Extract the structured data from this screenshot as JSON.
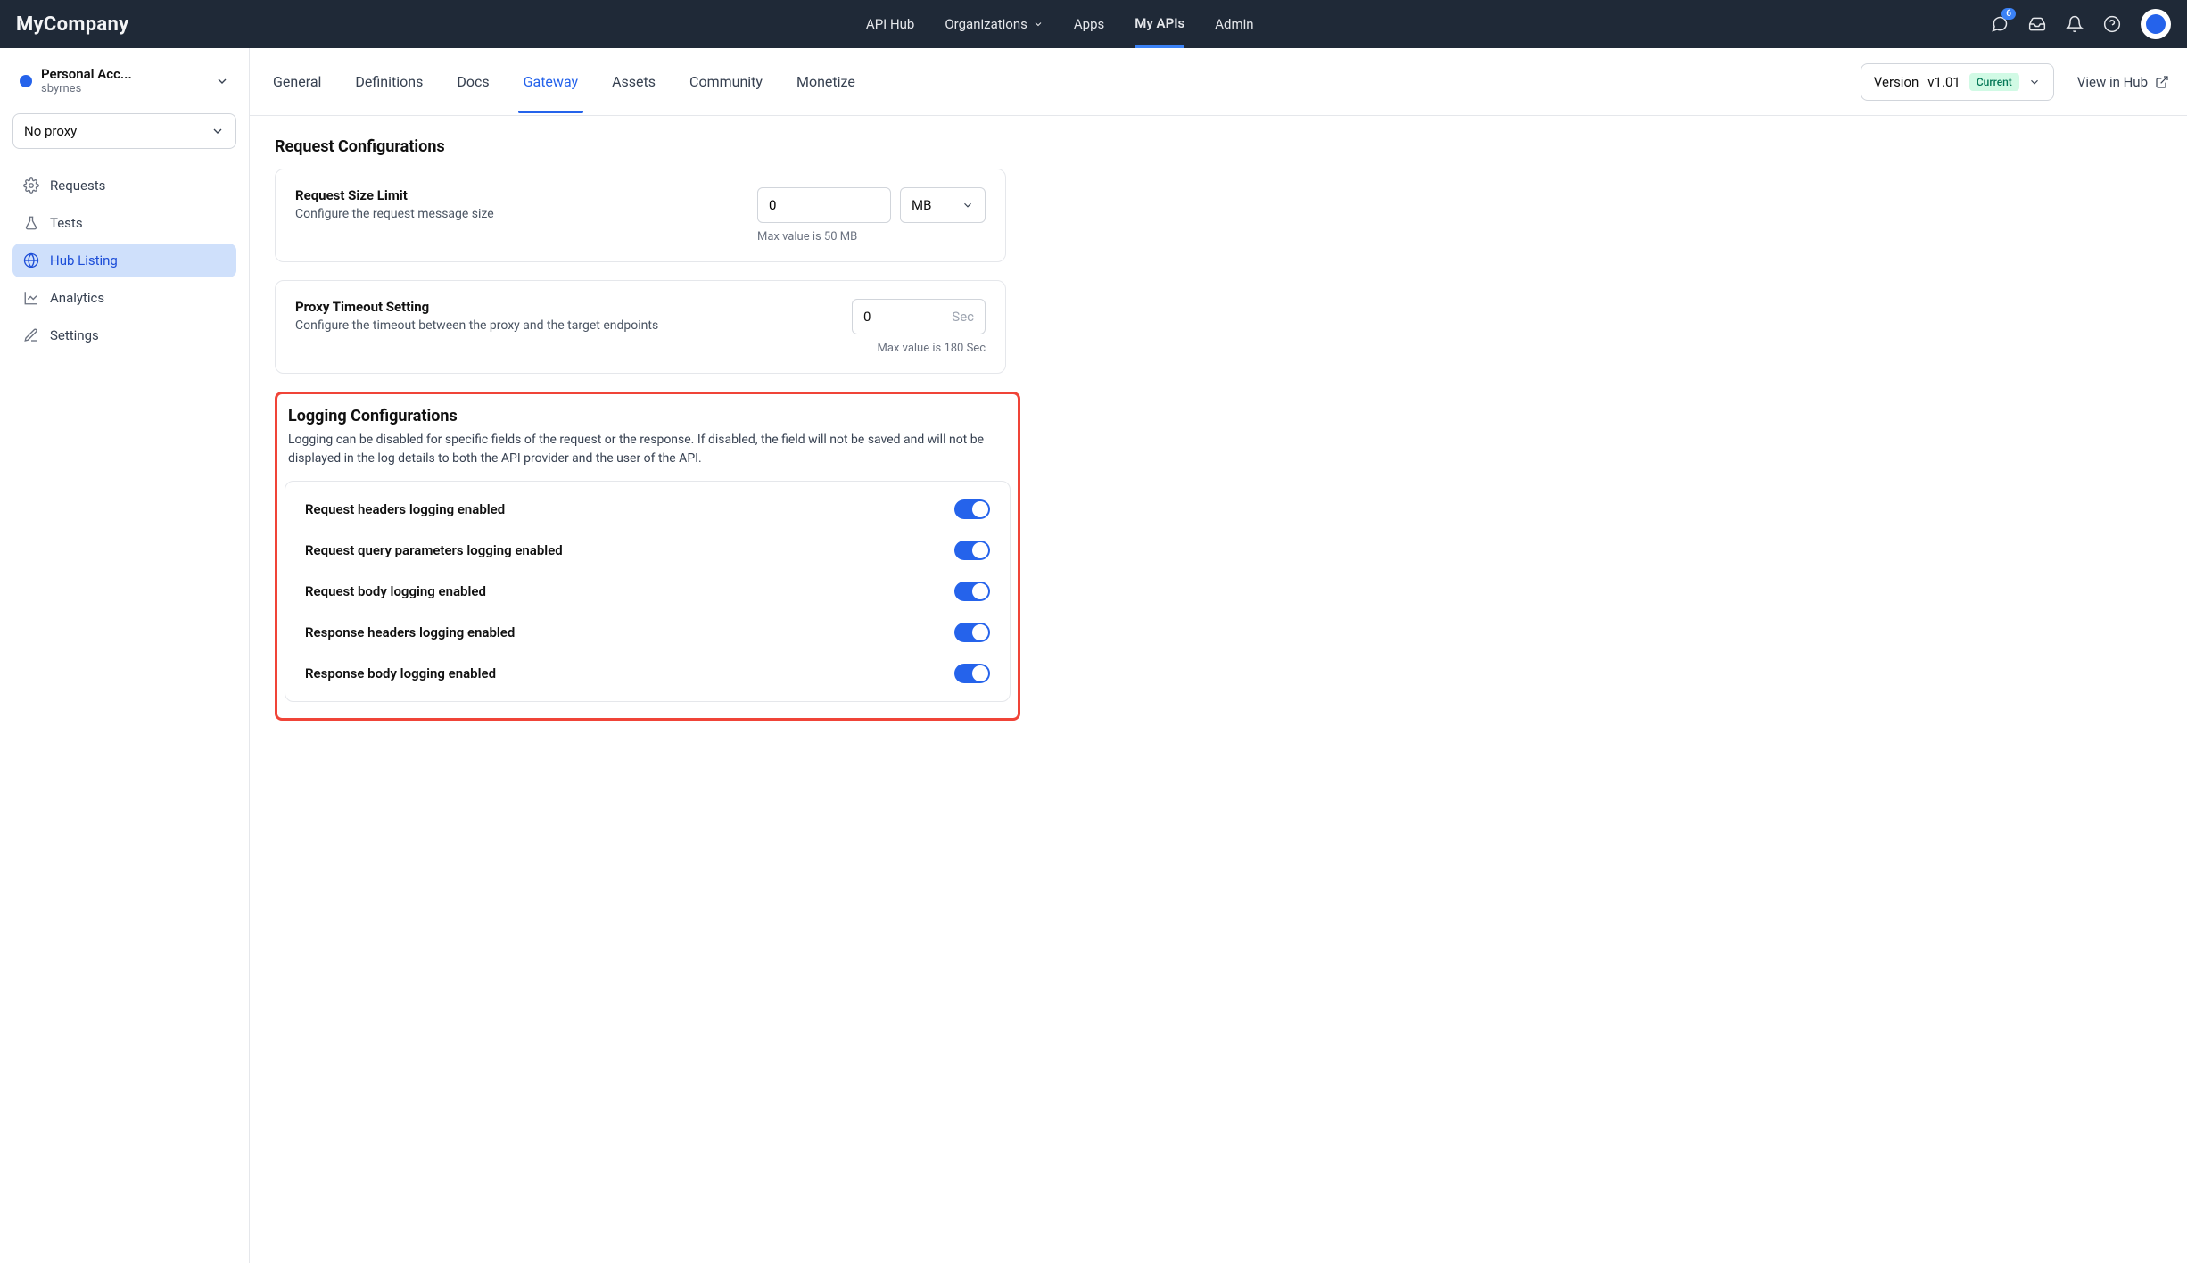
{
  "topbar": {
    "brand": "MyCompany",
    "nav": {
      "apihub": "API Hub",
      "organizations": "Organizations",
      "apps": "Apps",
      "myapis": "My APIs",
      "admin": "Admin"
    },
    "badge_count": "6"
  },
  "sidebar": {
    "account_name": "Personal Acc...",
    "account_user": "sbyrnes",
    "proxy_selector": "No proxy",
    "items": {
      "requests": "Requests",
      "tests": "Tests",
      "hublisting": "Hub Listing",
      "analytics": "Analytics",
      "settings": "Settings"
    }
  },
  "tabs": {
    "general": "General",
    "definitions": "Definitions",
    "docs": "Docs",
    "gateway": "Gateway",
    "assets": "Assets",
    "community": "Community",
    "monetize": "Monetize"
  },
  "version": {
    "prefix": "Version",
    "value": "v1.01",
    "badge": "Current"
  },
  "view_in_hub": "View in Hub",
  "sections": {
    "request_config_title": "Request Configurations",
    "request_size": {
      "label": "Request Size Limit",
      "desc": "Configure the request message size",
      "value": "0",
      "unit": "MB",
      "help": "Max value is 50 MB"
    },
    "proxy_timeout": {
      "label": "Proxy Timeout Setting",
      "desc": "Configure the timeout between the proxy and the target endpoints",
      "value": "0",
      "suffix": "Sec",
      "help": "Max value is 180 Sec"
    },
    "logging": {
      "title": "Logging Configurations",
      "desc": "Logging can be disabled for specific fields of the request or the response. If disabled, the field will not be saved and will not be displayed in the log details to both the API provider and the user of the API.",
      "toggles": {
        "req_headers": "Request headers logging enabled",
        "req_query": "Request query parameters logging enabled",
        "req_body": "Request body logging enabled",
        "res_headers": "Response headers logging enabled",
        "res_body": "Response body logging enabled"
      }
    }
  }
}
